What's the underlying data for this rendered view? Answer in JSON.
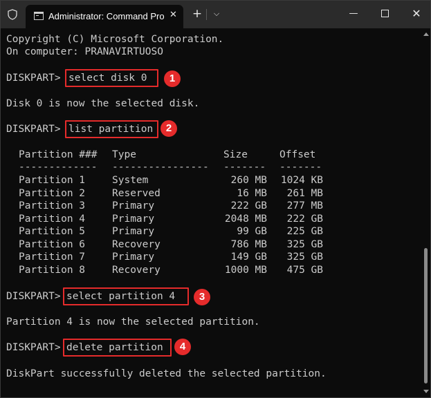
{
  "window": {
    "tab_title": "Administrator: Command Pro"
  },
  "terminal": {
    "intro": [
      "Copyright (C) Microsoft Corporation.",
      "On computer: PRANAVIRTUOSO"
    ],
    "prompt": "DISKPART> ",
    "commands": [
      {
        "text": "select disk 0",
        "step": "1"
      },
      {
        "text": "list partition",
        "step": "2"
      },
      {
        "text": "select partition 4",
        "step": "3"
      },
      {
        "text": "delete partition",
        "step": "4"
      }
    ],
    "responses": [
      "Disk 0 is now the selected disk.",
      "Partition 4 is now the selected partition.",
      "DiskPart successfully deleted the selected partition."
    ],
    "partition_table": {
      "headers": [
        "Partition ###",
        "Type",
        "Size",
        "Offset"
      ],
      "dividers": [
        "-------------",
        "----------------",
        "-------",
        "-------"
      ],
      "rows": [
        [
          "Partition 1",
          "System",
          "260 MB",
          "1024 KB"
        ],
        [
          "Partition 2",
          "Reserved",
          "16 MB",
          "261 MB"
        ],
        [
          "Partition 3",
          "Primary",
          "222 GB",
          "277 MB"
        ],
        [
          "Partition 4",
          "Primary",
          "2048 MB",
          "222 GB"
        ],
        [
          "Partition 5",
          "Primary",
          "99 GB",
          "225 GB"
        ],
        [
          "Partition 6",
          "Recovery",
          "786 MB",
          "325 GB"
        ],
        [
          "Partition 7",
          "Primary",
          "149 GB",
          "325 GB"
        ],
        [
          "Partition 8",
          "Recovery",
          "1000 MB",
          "475 GB"
        ]
      ]
    }
  },
  "icons": {
    "shield": "shield-icon",
    "tab": "terminal-icon",
    "close_tab": "close-icon",
    "new_tab": "plus-icon",
    "dropdown": "chevron-down-icon",
    "minimize": "minimize-icon",
    "maximize": "maximize-icon",
    "close_window": "close-icon"
  },
  "colors": {
    "background": "#0c0c0c",
    "titlebar": "#2b2b2b",
    "text": "#cccccc",
    "highlight": "#e52b2b"
  }
}
